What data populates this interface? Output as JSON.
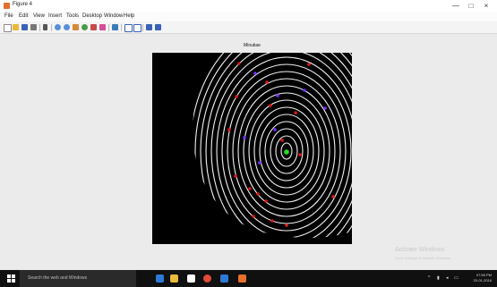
{
  "window": {
    "title": "Figure 4",
    "controls": {
      "minimize": "—",
      "maximize": "□",
      "close": "×"
    }
  },
  "menu": [
    "File",
    "Edit",
    "View",
    "Insert",
    "Tools",
    "Desktop",
    "Window",
    "Help"
  ],
  "toolbar": {
    "icons": [
      "new-figure",
      "open-file",
      "save-figure",
      "print-figure",
      "edit-plot",
      "zoom-in",
      "zoom-out",
      "pan",
      "rotate-3d",
      "data-cursor",
      "brush",
      "link-plot",
      "colorbar",
      "legend",
      "hide-plot-tools",
      "show-plot-tools"
    ]
  },
  "figure": {
    "title": "Minutiae",
    "minutiae_colors": {
      "ending": "#e01818",
      "bifurcation": "#7a2cff",
      "core": "#1ee31e"
    }
  },
  "watermark": {
    "line1": "Activate Windows",
    "line2": "Go to Settings to activate Windows."
  },
  "taskbar": {
    "search_placeholder": "Search the web and Windows",
    "apps": [
      "edge-icon",
      "file-explorer-icon",
      "store-icon",
      "chrome-icon",
      "mail-icon",
      "matlab-icon"
    ],
    "clock_time": "07:55 PM",
    "clock_date": "20-01-2016"
  }
}
